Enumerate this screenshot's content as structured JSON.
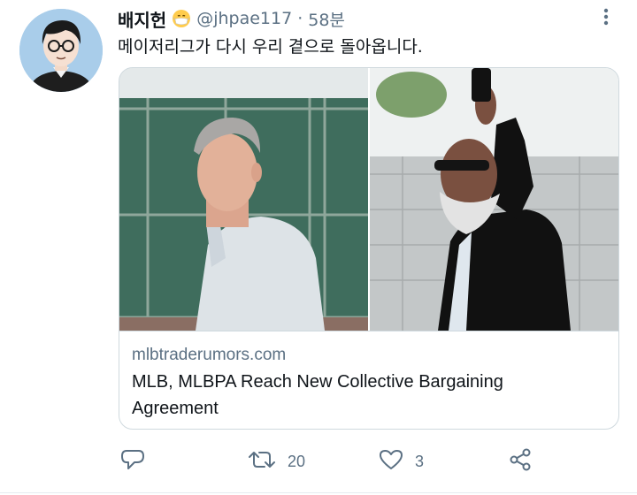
{
  "tweet": {
    "author_name": "배지헌",
    "handle": "@jhpae117",
    "separator": "·",
    "time": "58분",
    "text": "메이저리그가 다시 우리 곁으로 돌아옵니다."
  },
  "card": {
    "domain": "mlbtraderumors.com",
    "title": "MLB, MLBPA Reach New Collective Bargaining Agreement"
  },
  "actions": {
    "reply_count": "",
    "retweet_count": "20",
    "like_count": "3"
  },
  "colors": {
    "text_primary": "#0f1419",
    "text_secondary": "#5b7083",
    "border": "#cfd9de"
  },
  "icons": [
    "avatar-illustration",
    "mask-emoji",
    "more-icon",
    "reply-icon",
    "retweet-icon",
    "like-icon",
    "share-icon"
  ]
}
